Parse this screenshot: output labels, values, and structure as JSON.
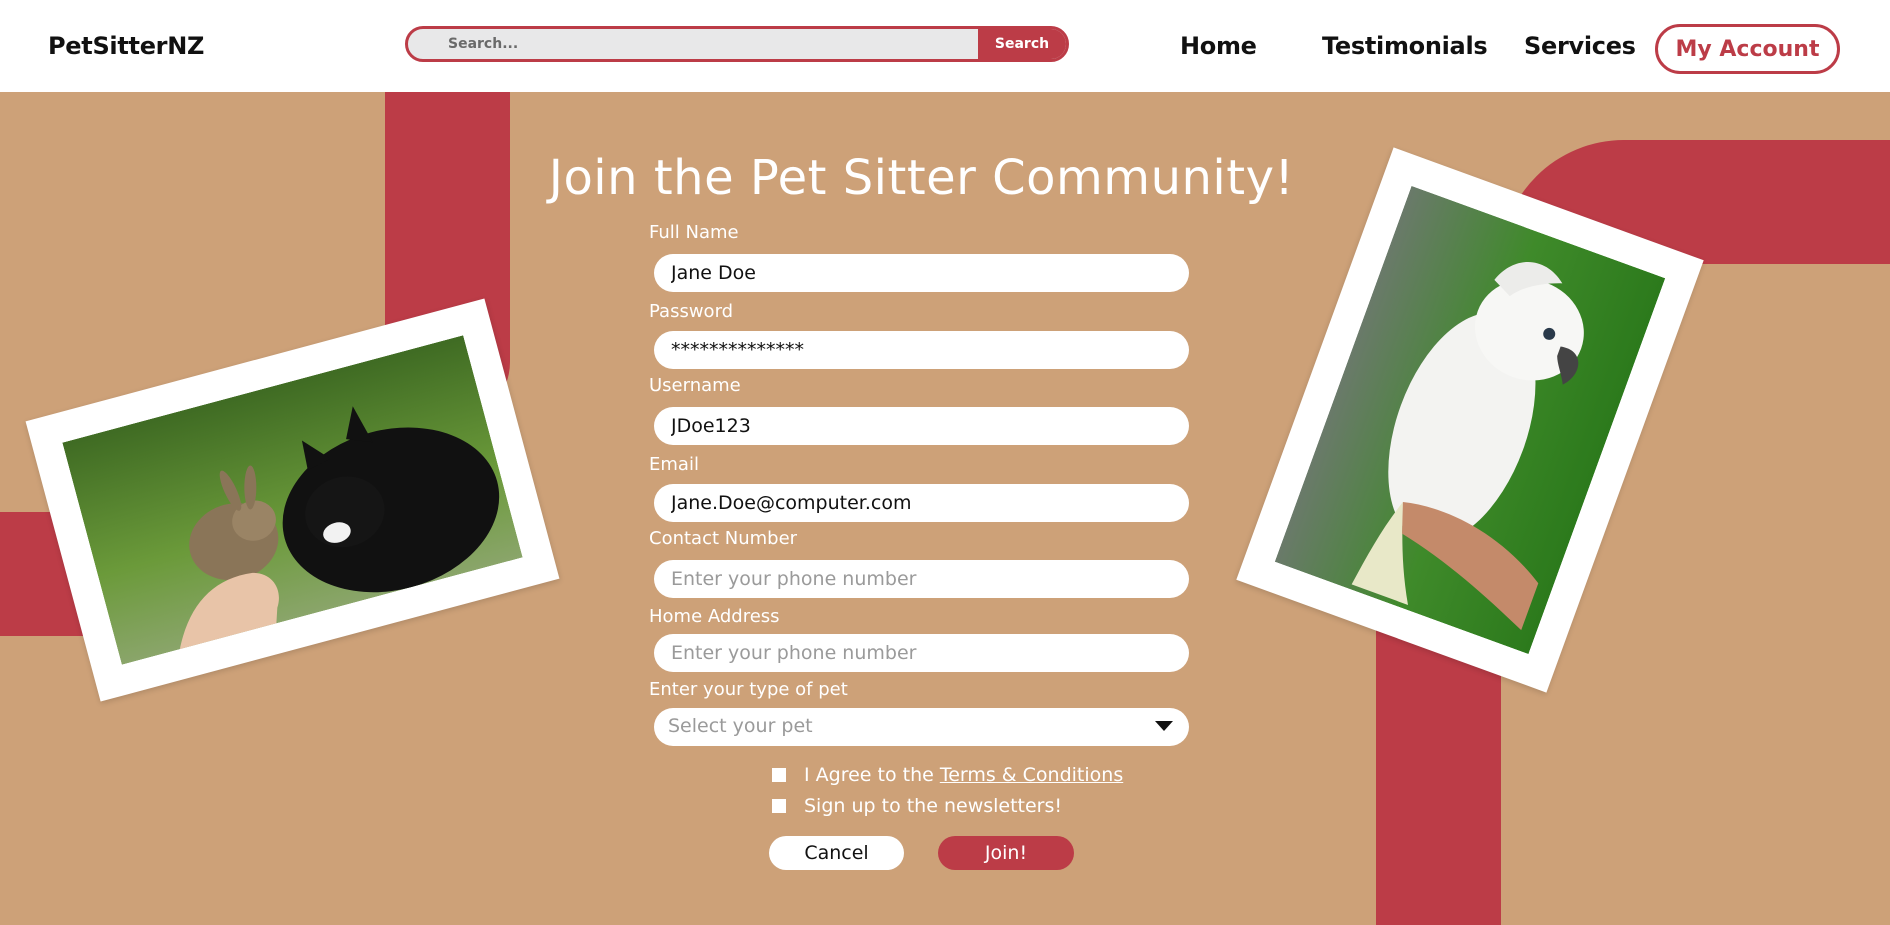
{
  "header": {
    "logo": "PetSitterNZ",
    "search": {
      "placeholder": "Search...",
      "button_label": "Search"
    },
    "nav": {
      "home": "Home",
      "testimonials": "Testimonials",
      "services": "Services",
      "account": "My Account"
    }
  },
  "form": {
    "title": "Join the Pet Sitter Community!",
    "fields": {
      "full_name": {
        "label": "Full Name",
        "value": "Jane Doe"
      },
      "password": {
        "label": "Password",
        "value": "**************"
      },
      "username": {
        "label": "Username",
        "value": "JDoe123"
      },
      "email": {
        "label": "Email",
        "value": "Jane.Doe@computer.com"
      },
      "contact": {
        "label": "Contact Number",
        "placeholder": "Enter your phone number"
      },
      "address": {
        "label": "Home Address",
        "placeholder": "Enter your phone number"
      },
      "pet_type": {
        "label": "Enter your type of pet",
        "placeholder": "Select your pet"
      }
    },
    "agree": {
      "text": "I Agree to the",
      "link": "Terms & Conditions"
    },
    "newsletter": {
      "text": "Sign up to the newsletters!"
    },
    "buttons": {
      "cancel": "Cancel",
      "join": "Join!"
    }
  },
  "colors": {
    "background": "#cda178",
    "accent": "#bc3c47",
    "header": "#ffffff"
  },
  "images": {
    "left": "rabbit-and-cat-photo",
    "right": "cockatoo-on-hand-photo"
  }
}
